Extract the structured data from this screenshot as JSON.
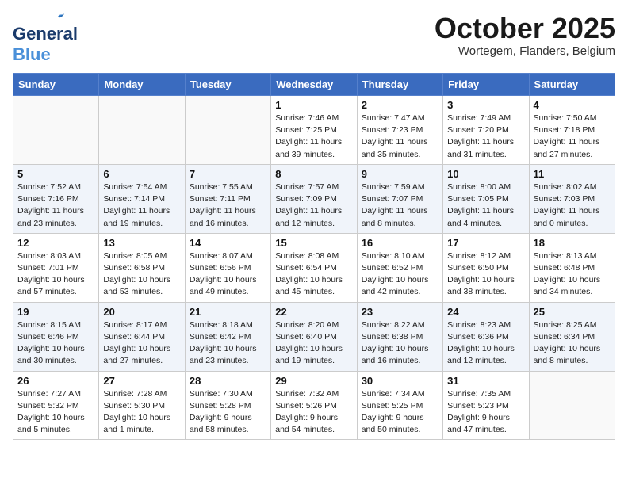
{
  "logo": {
    "line1": "General",
    "line2": "Blue"
  },
  "header": {
    "month": "October 2025",
    "location": "Wortegem, Flanders, Belgium"
  },
  "days_of_week": [
    "Sunday",
    "Monday",
    "Tuesday",
    "Wednesday",
    "Thursday",
    "Friday",
    "Saturday"
  ],
  "weeks": [
    [
      {
        "day": "",
        "info": ""
      },
      {
        "day": "",
        "info": ""
      },
      {
        "day": "",
        "info": ""
      },
      {
        "day": "1",
        "info": "Sunrise: 7:46 AM\nSunset: 7:25 PM\nDaylight: 11 hours and 39 minutes."
      },
      {
        "day": "2",
        "info": "Sunrise: 7:47 AM\nSunset: 7:23 PM\nDaylight: 11 hours and 35 minutes."
      },
      {
        "day": "3",
        "info": "Sunrise: 7:49 AM\nSunset: 7:20 PM\nDaylight: 11 hours and 31 minutes."
      },
      {
        "day": "4",
        "info": "Sunrise: 7:50 AM\nSunset: 7:18 PM\nDaylight: 11 hours and 27 minutes."
      }
    ],
    [
      {
        "day": "5",
        "info": "Sunrise: 7:52 AM\nSunset: 7:16 PM\nDaylight: 11 hours and 23 minutes."
      },
      {
        "day": "6",
        "info": "Sunrise: 7:54 AM\nSunset: 7:14 PM\nDaylight: 11 hours and 19 minutes."
      },
      {
        "day": "7",
        "info": "Sunrise: 7:55 AM\nSunset: 7:11 PM\nDaylight: 11 hours and 16 minutes."
      },
      {
        "day": "8",
        "info": "Sunrise: 7:57 AM\nSunset: 7:09 PM\nDaylight: 11 hours and 12 minutes."
      },
      {
        "day": "9",
        "info": "Sunrise: 7:59 AM\nSunset: 7:07 PM\nDaylight: 11 hours and 8 minutes."
      },
      {
        "day": "10",
        "info": "Sunrise: 8:00 AM\nSunset: 7:05 PM\nDaylight: 11 hours and 4 minutes."
      },
      {
        "day": "11",
        "info": "Sunrise: 8:02 AM\nSunset: 7:03 PM\nDaylight: 11 hours and 0 minutes."
      }
    ],
    [
      {
        "day": "12",
        "info": "Sunrise: 8:03 AM\nSunset: 7:01 PM\nDaylight: 10 hours and 57 minutes."
      },
      {
        "day": "13",
        "info": "Sunrise: 8:05 AM\nSunset: 6:58 PM\nDaylight: 10 hours and 53 minutes."
      },
      {
        "day": "14",
        "info": "Sunrise: 8:07 AM\nSunset: 6:56 PM\nDaylight: 10 hours and 49 minutes."
      },
      {
        "day": "15",
        "info": "Sunrise: 8:08 AM\nSunset: 6:54 PM\nDaylight: 10 hours and 45 minutes."
      },
      {
        "day": "16",
        "info": "Sunrise: 8:10 AM\nSunset: 6:52 PM\nDaylight: 10 hours and 42 minutes."
      },
      {
        "day": "17",
        "info": "Sunrise: 8:12 AM\nSunset: 6:50 PM\nDaylight: 10 hours and 38 minutes."
      },
      {
        "day": "18",
        "info": "Sunrise: 8:13 AM\nSunset: 6:48 PM\nDaylight: 10 hours and 34 minutes."
      }
    ],
    [
      {
        "day": "19",
        "info": "Sunrise: 8:15 AM\nSunset: 6:46 PM\nDaylight: 10 hours and 30 minutes."
      },
      {
        "day": "20",
        "info": "Sunrise: 8:17 AM\nSunset: 6:44 PM\nDaylight: 10 hours and 27 minutes."
      },
      {
        "day": "21",
        "info": "Sunrise: 8:18 AM\nSunset: 6:42 PM\nDaylight: 10 hours and 23 minutes."
      },
      {
        "day": "22",
        "info": "Sunrise: 8:20 AM\nSunset: 6:40 PM\nDaylight: 10 hours and 19 minutes."
      },
      {
        "day": "23",
        "info": "Sunrise: 8:22 AM\nSunset: 6:38 PM\nDaylight: 10 hours and 16 minutes."
      },
      {
        "day": "24",
        "info": "Sunrise: 8:23 AM\nSunset: 6:36 PM\nDaylight: 10 hours and 12 minutes."
      },
      {
        "day": "25",
        "info": "Sunrise: 8:25 AM\nSunset: 6:34 PM\nDaylight: 10 hours and 8 minutes."
      }
    ],
    [
      {
        "day": "26",
        "info": "Sunrise: 7:27 AM\nSunset: 5:32 PM\nDaylight: 10 hours and 5 minutes."
      },
      {
        "day": "27",
        "info": "Sunrise: 7:28 AM\nSunset: 5:30 PM\nDaylight: 10 hours and 1 minute."
      },
      {
        "day": "28",
        "info": "Sunrise: 7:30 AM\nSunset: 5:28 PM\nDaylight: 9 hours and 58 minutes."
      },
      {
        "day": "29",
        "info": "Sunrise: 7:32 AM\nSunset: 5:26 PM\nDaylight: 9 hours and 54 minutes."
      },
      {
        "day": "30",
        "info": "Sunrise: 7:34 AM\nSunset: 5:25 PM\nDaylight: 9 hours and 50 minutes."
      },
      {
        "day": "31",
        "info": "Sunrise: 7:35 AM\nSunset: 5:23 PM\nDaylight: 9 hours and 47 minutes."
      },
      {
        "day": "",
        "info": ""
      }
    ]
  ]
}
